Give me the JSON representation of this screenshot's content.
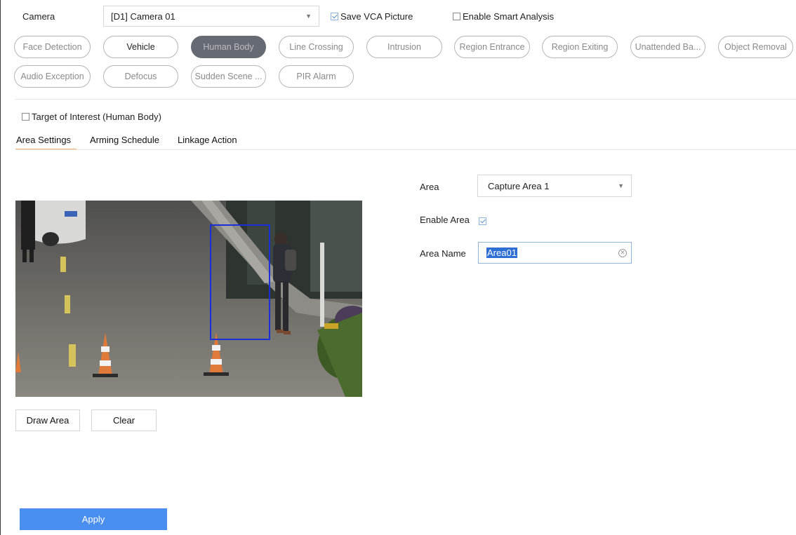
{
  "camera": {
    "label": "Camera",
    "selected": "[D1] Camera 01",
    "save_vca_label": "Save VCA Picture",
    "save_vca_checked": true,
    "smart_analysis_label": "Enable Smart Analysis",
    "smart_analysis_checked": false
  },
  "detection_types": [
    {
      "label": "Face Detection",
      "style": "disabled"
    },
    {
      "label": "Vehicle",
      "style": "enabled"
    },
    {
      "label": "Human Body",
      "style": "active"
    },
    {
      "label": "Line Crossing",
      "style": "disabled"
    },
    {
      "label": "Intrusion",
      "style": "disabled"
    },
    {
      "label": "Region Entrance",
      "style": "disabled"
    },
    {
      "label": "Region Exiting",
      "style": "disabled"
    },
    {
      "label": "Unattended Ba...",
      "style": "disabled"
    },
    {
      "label": "Object Removal",
      "style": "disabled"
    },
    {
      "label": "Audio Exception",
      "style": "disabled"
    },
    {
      "label": "Defocus",
      "style": "disabled"
    },
    {
      "label": "Sudden Scene ...",
      "style": "disabled"
    },
    {
      "label": "PIR Alarm",
      "style": "disabled"
    }
  ],
  "target_of_interest": {
    "label": "Target of Interest (Human Body)",
    "checked": false
  },
  "tabs": [
    "Area Settings",
    "Arming Schedule",
    "Linkage Action"
  ],
  "active_tab": "Area Settings",
  "area": {
    "area_label": "Area",
    "area_selected": "Capture Area 1",
    "enable_area_label": "Enable Area",
    "enable_area_checked": true,
    "area_name_label": "Area Name",
    "area_name_value": "Area01"
  },
  "buttons": {
    "draw_area": "Draw Area",
    "clear": "Clear",
    "apply": "Apply"
  },
  "colors": {
    "accent": "#4a8ff0",
    "active_pill": "#666a72",
    "tab_underline": "#f0b27a",
    "area_box": "#1a2fd9"
  }
}
